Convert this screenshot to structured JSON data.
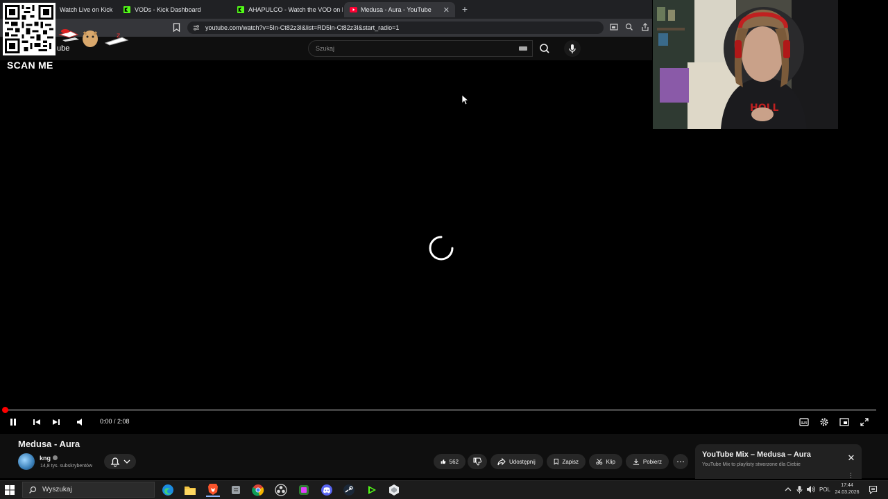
{
  "browser": {
    "tabs": [
      {
        "label": "Watch Live on Kick",
        "favicon": "kick-icon"
      },
      {
        "label": "VODs - Kick Dashboard",
        "favicon": "kick-icon"
      },
      {
        "label": "AHAPULCO - Watch the VOD on Kick",
        "favicon": "kick-icon"
      },
      {
        "label": "Medusa - Aura - YouTube",
        "favicon": "youtube-icon",
        "active": true
      }
    ],
    "url": "youtube.com/watch?v=5In-Ct82z3I&list=RD5In-Ct82z3I&start_radio=1"
  },
  "overlay": {
    "scan_label": "SCAN ME",
    "yt_partial": "ube"
  },
  "youtube": {
    "search_placeholder": "Szukaj",
    "player": {
      "time": "0:00 / 2:08",
      "progress_fraction": 0.0
    },
    "video": {
      "title": "Medusa - Aura",
      "channel": "kng",
      "subscribers": "14,8 tys. subskrybentów",
      "likes": "562",
      "actions": {
        "share": "Udostępnij",
        "save": "Zapisz",
        "clip": "Klip",
        "download": "Pobierz"
      }
    },
    "mix": {
      "title": "YouTube Mix – Medusa – Aura",
      "subtitle": "YouTube Mix to playlisty stworzone dla Ciebie"
    }
  },
  "taskbar": {
    "search_label": "Wyszukaj",
    "lang": "POL",
    "time": "17:44",
    "date": "24.03.2026"
  },
  "colors": {
    "accent_red": "#ff0000",
    "kick_green": "#53fc18",
    "brave_orange": "#fb542b"
  }
}
